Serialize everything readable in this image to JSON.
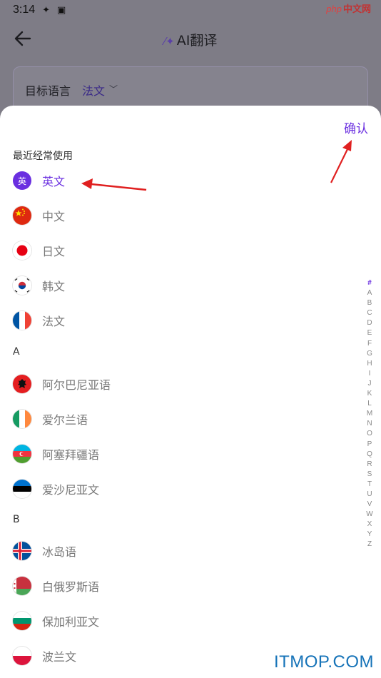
{
  "status": {
    "time": "3:14"
  },
  "site_mark": {
    "text": "php",
    "cn": "中文网"
  },
  "nav": {
    "title": "AI翻译"
  },
  "target_lang": {
    "label": "目标语言",
    "value": "法文"
  },
  "sheet": {
    "confirm": "确认"
  },
  "sections": {
    "recent": "最近经常使用",
    "a": "A",
    "b": "B"
  },
  "recent": [
    {
      "name": "英文",
      "badge": "英",
      "active": true
    },
    {
      "name": "中文",
      "flag": "china-flag-icon"
    },
    {
      "name": "日文",
      "flag": "japan-flag-icon"
    },
    {
      "name": "韩文",
      "flag": "korea-flag-icon"
    },
    {
      "name": "法文",
      "flag": "france-flag-icon"
    }
  ],
  "group_a": [
    {
      "name": "阿尔巴尼亚语",
      "flag": "albania-flag-icon"
    },
    {
      "name": "爱尔兰语",
      "flag": "ireland-flag-icon"
    },
    {
      "name": "阿塞拜疆语",
      "flag": "azerbaijan-flag-icon"
    },
    {
      "name": "爱沙尼亚文",
      "flag": "estonia-flag-icon"
    }
  ],
  "group_b": [
    {
      "name": "冰岛语",
      "flag": "iceland-flag-icon"
    },
    {
      "name": "白俄罗斯语",
      "flag": "belarus-flag-icon"
    },
    {
      "name": "保加利亚文",
      "flag": "bulgaria-flag-icon"
    },
    {
      "name": "波兰文",
      "flag": "poland-flag-icon"
    }
  ],
  "index_letters": [
    "#",
    "A",
    "B",
    "C",
    "D",
    "E",
    "F",
    "G",
    "H",
    "I",
    "J",
    "K",
    "L",
    "M",
    "N",
    "O",
    "P",
    "Q",
    "R",
    "S",
    "T",
    "U",
    "V",
    "W",
    "X",
    "Y",
    "Z"
  ],
  "watermark": "ITMOP.COM",
  "colors": {
    "accent": "#6a2fe0",
    "annotation_arrow": "#e02020",
    "watermark": "#1673b8"
  }
}
